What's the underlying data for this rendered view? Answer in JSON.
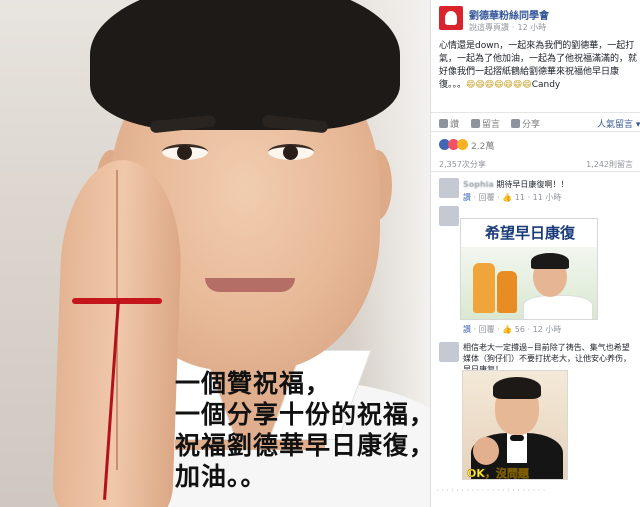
{
  "photo": {
    "caption_lines": [
      "一個贊祝福，",
      "一個分享十份的祝福，",
      "祝福劉德華早日康復，",
      "加油。。"
    ]
  },
  "post": {
    "page_name": "劉德華粉絲同學會",
    "page_meta": "說這專頁讚",
    "time": "12 小時",
    "text": "心情還是down，一起來為我們的劉德華，一起打氣，一起為了他加油，一起為了他祝福滿滿的，就好像我們一起摺紙鶴給劉德華來祝福他早日康復。。。",
    "emoji": "😄😄😄😄😄😄😄",
    "signature": "Candy"
  },
  "actions": {
    "like": "讚",
    "comment": "留言",
    "share": "分享",
    "sort": "人氣留言"
  },
  "reactions": {
    "count": "2.2萬",
    "shares": "2,357次分享",
    "comments": "1,242則留言"
  },
  "comments": [
    {
      "text_prefix": "Sophia",
      "text": "期待早日康復啊！！",
      "meta_like": "讚",
      "meta_reply": "回覆",
      "meta_count": "11",
      "meta_time": "11 小時"
    },
    {
      "meta_like": "讚",
      "meta_reply": "回覆",
      "meta_count": "56",
      "meta_time": "12 小時",
      "image_title": "希望早日康復"
    },
    {
      "text": "相信老大一定撐過~目前除了祷告、集气也希望媒体（狗仔们）不要打扰老大，让他安心养伤，早日康复！",
      "image_caption": "OK，沒問題"
    }
  ],
  "colors": {
    "link_blue": "#365899",
    "meta_grey": "#90949c",
    "brand_red": "#d9232d",
    "caption_black": "#111111"
  }
}
